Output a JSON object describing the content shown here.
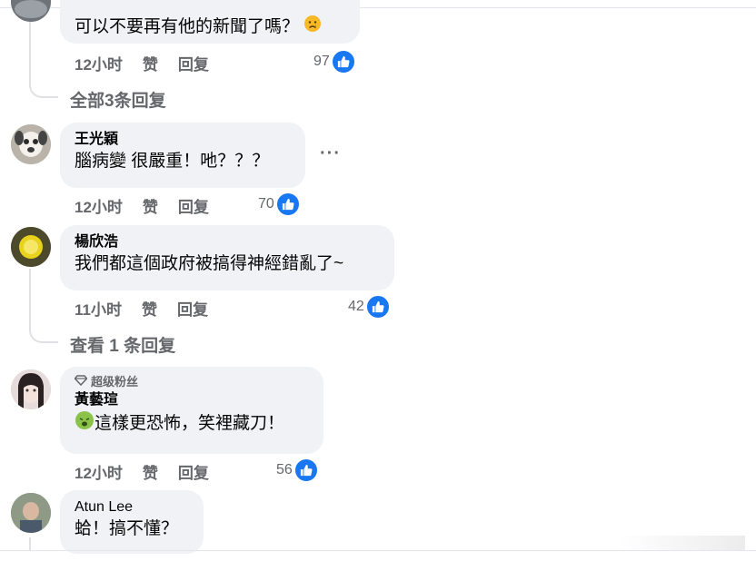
{
  "comments": [
    {
      "author": "",
      "text": "可以不要再有他的新聞了嗎？",
      "emoji": "sad-face-emoji",
      "time": "12小时",
      "like_label": "赞",
      "reply_label": "回复",
      "likes": "97",
      "replies_link": "全部3条回复"
    },
    {
      "author": "王光穎",
      "text": "腦病變 很嚴重！吔？？？",
      "time": "12小时",
      "like_label": "赞",
      "reply_label": "回复",
      "likes": "70",
      "more": "···"
    },
    {
      "author": "楊欣浩",
      "text": "我們都這個政府被搞得神經錯亂了~",
      "time": "11小时",
      "like_label": "赞",
      "reply_label": "回复",
      "likes": "42",
      "replies_link": "查看 1 条回复"
    },
    {
      "badge": "超级粉丝",
      "author": "黃藝瑄",
      "text": "這樣更恐怖，笑裡藏刀！",
      "emoji": "nauseated-face-emoji",
      "time": "12小时",
      "like_label": "赞",
      "reply_label": "回复",
      "likes": "56"
    },
    {
      "author": "Atun Lee",
      "text": "蛤！搞不懂？"
    }
  ],
  "colors": {
    "accent": "#1877f2",
    "bubble": "#f0f2f5",
    "meta": "#65676b"
  }
}
